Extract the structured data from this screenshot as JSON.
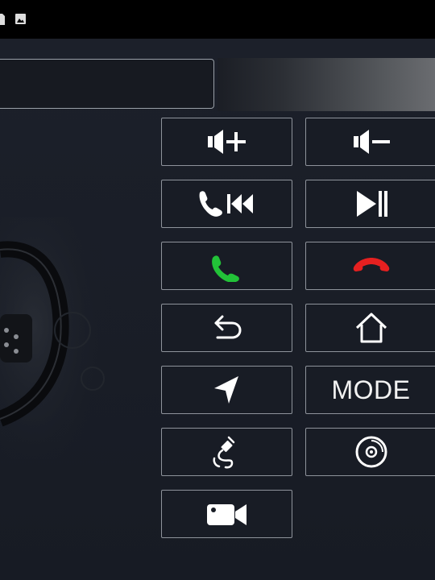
{
  "status_bar": {
    "icons": [
      "sd-card-icon",
      "image-icon"
    ]
  },
  "header": {
    "field_value": ""
  },
  "background": {
    "image": "steering-wheel-photo"
  },
  "buttons": [
    {
      "id": "volume-up-button",
      "icon": "volume-up-icon"
    },
    {
      "id": "volume-down-button",
      "icon": "volume-down-icon"
    },
    {
      "id": "call-previous-button",
      "icon": "phone-previous-icon"
    },
    {
      "id": "next-track-button",
      "icon": "play-next-icon"
    },
    {
      "id": "answer-call-button",
      "icon": "phone-answer-icon",
      "color": "#22c238"
    },
    {
      "id": "hang-up-button",
      "icon": "phone-hangup-icon",
      "color": "#e52020"
    },
    {
      "id": "back-button",
      "icon": "back-arrow-icon"
    },
    {
      "id": "home-button",
      "icon": "home-icon"
    },
    {
      "id": "navigation-button",
      "icon": "navigation-arrow-icon"
    },
    {
      "id": "mode-button",
      "label": "MODE"
    },
    {
      "id": "usb-button",
      "icon": "usb-cable-icon"
    },
    {
      "id": "disc-button",
      "icon": "disc-icon"
    },
    {
      "id": "camera-button",
      "icon": "video-camera-icon"
    }
  ]
}
